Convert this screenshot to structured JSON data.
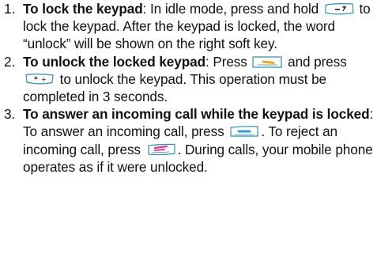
{
  "steps": [
    {
      "number": "1.",
      "title": "To lock the keypad",
      "text_1": ": In idle mode, press and hold ",
      "key_1": "star-key-icon",
      "text_2": " to lock the keypad. After the keypad is locked, the word “unlock” will be shown on the right soft key."
    },
    {
      "number": "2.",
      "title": "To unlock the locked keypad",
      "text_1": ": Press ",
      "key_1": "right-soft-key-icon",
      "text_2": " and press ",
      "key_2": "star-key-icon",
      "text_3": " to unlock the keypad. This operation must be completed in 3 seconds."
    },
    {
      "number": "3.",
      "title": "To answer an incoming call while the keypad is locked",
      "text_1": ": To answer an incoming call, press ",
      "key_1": "send-key-icon",
      "text_2": ". To reject an incoming call, press ",
      "key_2": "end-key-icon",
      "text_3": ". During calls, your mobile phone operates as if it were unlocked."
    }
  ],
  "colors": {
    "key_outline": "#2f8fb8",
    "key_fill": "#ffffff",
    "send_mark": "#2e9fcf",
    "soft_mark": "#f2a51f",
    "end_mark": "#e0459a",
    "text": "#111111"
  }
}
